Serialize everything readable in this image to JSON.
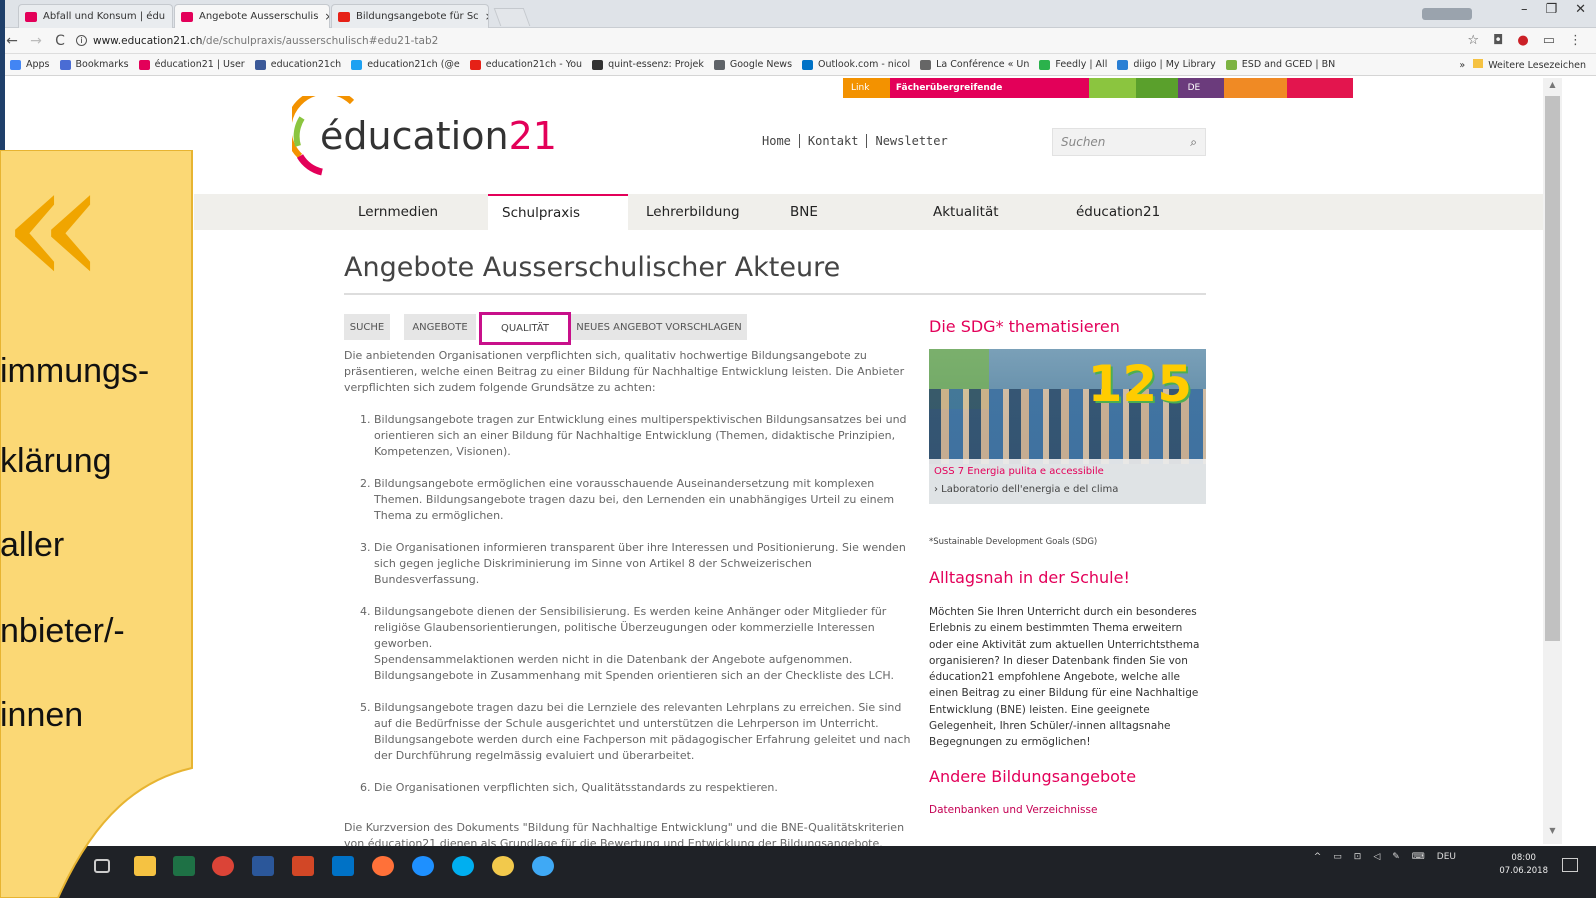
{
  "browser": {
    "tabs": [
      {
        "title": "Abfall und Konsum | édu",
        "close": "×"
      },
      {
        "title": "Angebote Ausserschulis",
        "close": "×"
      },
      {
        "title": "Bildungsangebote für Sc",
        "close": "×"
      }
    ],
    "window_controls": [
      "–",
      "❐",
      "✕"
    ],
    "nav_back": "←",
    "nav_forward": "→",
    "nav_reload": "C",
    "url_host": "www.education21.ch",
    "url_path": "/de/schulpraxis/ausserschulisch#edu21-tab2",
    "bookmarks": [
      {
        "label": "Apps",
        "color": "#4285f4"
      },
      {
        "label": "Bookmarks",
        "color": "#4a6cd4"
      },
      {
        "label": "éducation21 | User",
        "color": "#e30059"
      },
      {
        "label": "education21ch",
        "color": "#3b5998"
      },
      {
        "label": "education21ch (@e",
        "color": "#1da1f2"
      },
      {
        "label": "education21ch - You",
        "color": "#e62117"
      },
      {
        "label": "quint-essenz: Projek",
        "color": "#333333"
      },
      {
        "label": "Google News",
        "color": "#5f6368"
      },
      {
        "label": "Outlook.com - nicol",
        "color": "#0072c6"
      },
      {
        "label": "La Conférence « Un",
        "color": "#666666"
      },
      {
        "label": "Feedly | All",
        "color": "#2bb24c"
      },
      {
        "label": "diigo | My Library",
        "color": "#2a7fd4"
      },
      {
        "label": "ESD and GCED | BN",
        "color": "#7cb342"
      }
    ],
    "bookmarks_more": "»",
    "bookmarks_other": "Weitere Lesezeichen"
  },
  "site": {
    "colorbar": {
      "link": "Link",
      "faecher": "Fächerübergreifende Bildungszugänge",
      "lang": "DE"
    },
    "logo": {
      "prefix": "éducation",
      "suffix": "21"
    },
    "toplinks": [
      "Home",
      "Kontakt",
      "Newsletter"
    ],
    "search_placeholder": "Suchen",
    "menu": [
      "Lernmedien",
      "Schulpraxis",
      "Lehrerbildung",
      "BNE",
      "Aktualität",
      "éducation21"
    ],
    "active_menu": "Schulpraxis",
    "page_title": "Angebote Ausserschulischer Akteure",
    "subtabs": [
      "SUCHE",
      "ANGEBOTE",
      "QUALITÄT",
      "NEUES ANGEBOT VORSCHLAGEN"
    ],
    "active_subtab": "QUALITÄT",
    "intro": "Die anbietenden Organisationen verpflichten sich, qualitativ hochwertige Bildungsangebote zu präsentieren, welche einen Beitrag zu einer Bildung für Nachhaltige Entwicklung leisten. Die Anbieter verpflichten sich zudem folgende Grundsätze zu achten:",
    "principles": [
      "Bildungsangebote tragen zur Entwicklung eines multiperspektivischen Bildungsansatzes bei und orientieren sich an einer Bildung für Nachhaltige Entwicklung (Themen, didaktische Prinzipien, Kompetenzen, Visionen).",
      "Bildungsangebote ermöglichen  eine vorausschauende Auseinandersetzung mit komplexen Themen. Bildungsangebote tragen dazu bei, den Lernenden ein unabhängiges Urteil zu einem Thema zu ermöglichen.",
      "Die Organisationen informieren transparent über ihre Interessen und Positionierung.  Sie wenden sich gegen jegliche Diskriminierung im Sinne von Artikel 8 der Schweizerischen Bundesverfassung.",
      "Bildungsangebote dienen der Sensibilisierung. Es werden keine Anhänger oder Mitglieder für religiöse Glaubensorientierungen, politische Überzeugungen oder kommerzielle Interessen geworben.\nSpendensammelaktionen werden nicht in die Datenbank der Angebote aufgenommen. Bildungsangebote in Zusammenhang mit Spenden orientieren sich an der Checkliste des LCH.",
      "Bildungsangebote tragen dazu bei die Lernziele des relevanten Lehrplans zu erreichen. Sie sind auf die Bedürfnisse der Schule ausgerichtet und unterstützen die Lehrperson im Unterricht. Bildungsangebote werden durch eine Fachperson mit pädagogischer Erfahrung geleitet und nach der Durchführung regelmässig evaluiert und überarbeitet.",
      "Die Organisationen verpflichten sich, Qualitätsstandards zu respektieren."
    ],
    "outro": "Die Kurzversion des Dokuments \"Bildung für Nachhaltige Entwicklung\" und die BNE-Qualitätskriterien von éducation21 dienen als Grundlage für die Bewertung und Entwicklung der Bildungsangebote.",
    "sidebar": {
      "sdg_title": "Die SDG* thematisieren",
      "sdg_number": "125",
      "sdg_caption1": "OSS 7 Energia pulita e accessibile",
      "sdg_caption2": "› Laboratorio dell'energia e del clima",
      "sdg_note": "*Sustainable Development Goals (SDG)",
      "alltag_title": "Alltagsnah in der Schule!",
      "alltag_text": "Möchten Sie Ihren Unterricht durch ein besonderes Erlebnis zu einem bestimmten Thema erweitern oder eine Aktivität zum aktuellen Unterrichtsthema organisieren? In dieser Datenbank finden Sie von éducation21 empfohlene Angebote, welche alle einen Beitrag zu einer Bildung für eine Nachhaltige Entwicklung (BNE) leisten. Eine geeignete Gelegenheit, Ihren Schüler/-innen alltagsnahe Begegnungen zu ermöglichen!",
      "andere_title": "Andere Bildungsangebote",
      "andere_link": "Datenbanken und Verzeichnisse"
    }
  },
  "callout": {
    "quote": "«",
    "lines": [
      "immungs-",
      "klärung",
      " aller",
      "nbieter/-",
      "innen"
    ]
  },
  "taskbar": {
    "lang": "DEU",
    "time": "08:00",
    "date": "07.06.2018"
  },
  "colors": {
    "brand_magenta": "#e30059",
    "brand_orange": "#f39200",
    "callout_yellow": "#fbd875",
    "quote_gold": "#f0a500",
    "active_subtab_border": "#c8108a"
  }
}
